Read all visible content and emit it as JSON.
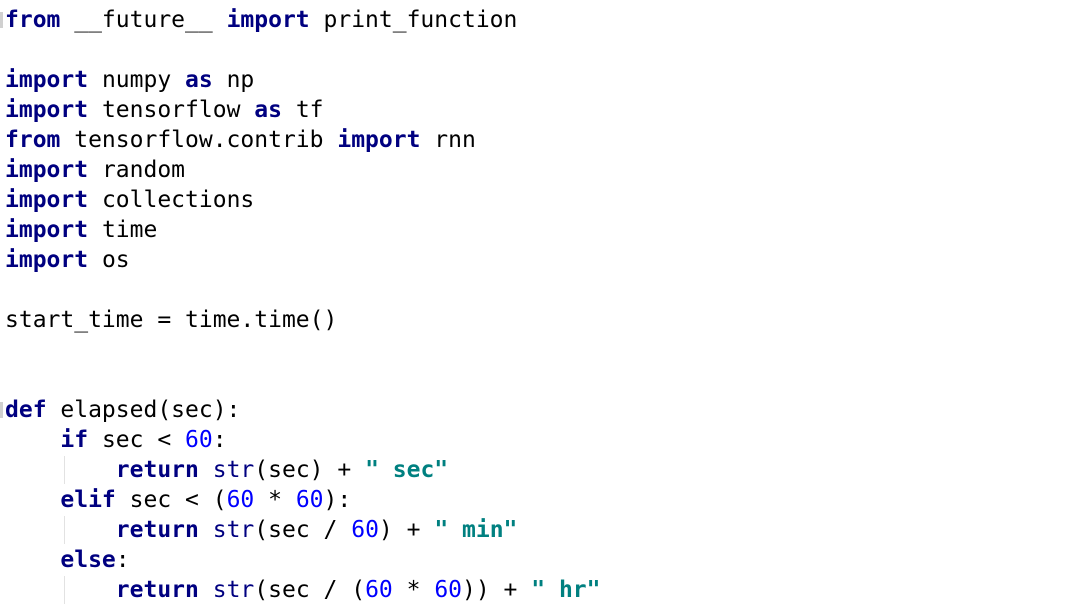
{
  "editor": {
    "lines": [
      [
        {
          "t": "from",
          "c": "kw"
        },
        {
          "t": " __future__ ",
          "c": "plain"
        },
        {
          "t": "import",
          "c": "kw"
        },
        {
          "t": " print_function",
          "c": "plain"
        }
      ],
      [],
      [
        {
          "t": "import",
          "c": "kw"
        },
        {
          "t": " numpy ",
          "c": "plain"
        },
        {
          "t": "as",
          "c": "kw"
        },
        {
          "t": " np",
          "c": "plain"
        }
      ],
      [
        {
          "t": "import",
          "c": "kw"
        },
        {
          "t": " tensorflow ",
          "c": "plain"
        },
        {
          "t": "as",
          "c": "kw"
        },
        {
          "t": " tf",
          "c": "plain"
        }
      ],
      [
        {
          "t": "from",
          "c": "kw"
        },
        {
          "t": " tensorflow.contrib ",
          "c": "plain"
        },
        {
          "t": "import",
          "c": "kw"
        },
        {
          "t": " rnn",
          "c": "plain"
        }
      ],
      [
        {
          "t": "import",
          "c": "kw"
        },
        {
          "t": " random",
          "c": "plain"
        }
      ],
      [
        {
          "t": "import",
          "c": "kw"
        },
        {
          "t": " collections",
          "c": "plain"
        }
      ],
      [
        {
          "t": "import",
          "c": "kw"
        },
        {
          "t": " time",
          "c": "plain"
        }
      ],
      [
        {
          "t": "import",
          "c": "kw"
        },
        {
          "t": " os",
          "c": "plain"
        }
      ],
      [],
      [
        {
          "t": "start_time = time.time()",
          "c": "plain"
        }
      ],
      [],
      [],
      [
        {
          "t": "def",
          "c": "kw"
        },
        {
          "t": " elapsed(sec):",
          "c": "plain"
        }
      ],
      [
        {
          "t": "    ",
          "c": "plain"
        },
        {
          "t": "if",
          "c": "kw"
        },
        {
          "t": " sec < ",
          "c": "plain"
        },
        {
          "t": "60",
          "c": "num"
        },
        {
          "t": ":",
          "c": "plain"
        }
      ],
      [
        {
          "t": "        ",
          "c": "plain"
        },
        {
          "t": "return",
          "c": "kw"
        },
        {
          "t": " ",
          "c": "plain"
        },
        {
          "t": "str",
          "c": "bi"
        },
        {
          "t": "(sec) + ",
          "c": "plain"
        },
        {
          "t": "\" sec\"",
          "c": "str"
        }
      ],
      [
        {
          "t": "    ",
          "c": "plain"
        },
        {
          "t": "elif",
          "c": "kw"
        },
        {
          "t": " sec < (",
          "c": "plain"
        },
        {
          "t": "60",
          "c": "num"
        },
        {
          "t": " * ",
          "c": "plain"
        },
        {
          "t": "60",
          "c": "num"
        },
        {
          "t": "):",
          "c": "plain"
        }
      ],
      [
        {
          "t": "        ",
          "c": "plain"
        },
        {
          "t": "return",
          "c": "kw"
        },
        {
          "t": " ",
          "c": "plain"
        },
        {
          "t": "str",
          "c": "bi"
        },
        {
          "t": "(sec / ",
          "c": "plain"
        },
        {
          "t": "60",
          "c": "num"
        },
        {
          "t": ") + ",
          "c": "plain"
        },
        {
          "t": "\" min\"",
          "c": "str"
        }
      ],
      [
        {
          "t": "    ",
          "c": "plain"
        },
        {
          "t": "else",
          "c": "kw"
        },
        {
          "t": ":",
          "c": "plain"
        }
      ],
      [
        {
          "t": "        ",
          "c": "plain"
        },
        {
          "t": "return",
          "c": "kw"
        },
        {
          "t": " ",
          "c": "plain"
        },
        {
          "t": "str",
          "c": "bi"
        },
        {
          "t": "(sec / (",
          "c": "plain"
        },
        {
          "t": "60",
          "c": "num"
        },
        {
          "t": " * ",
          "c": "plain"
        },
        {
          "t": "60",
          "c": "num"
        },
        {
          "t": ")) + ",
          "c": "plain"
        },
        {
          "t": "\" hr\"",
          "c": "str"
        }
      ]
    ]
  },
  "colors": {
    "background": "#ffffff",
    "keyword": "#000080",
    "number": "#0000ff",
    "string": "#008080",
    "text": "#000000",
    "indent_guide": "#e2e2e2"
  }
}
